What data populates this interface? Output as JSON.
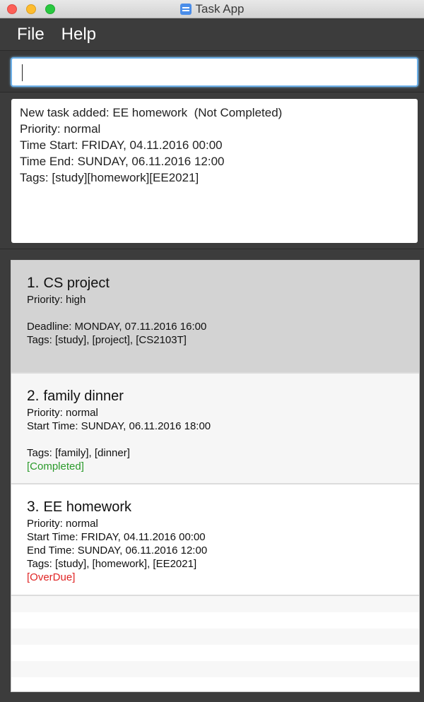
{
  "window": {
    "title": "Task App",
    "colors": {
      "close": "#fc5f57",
      "minimize": "#fdbc2e",
      "maximize": "#29c840",
      "accent": "#6db0e8"
    }
  },
  "menu": {
    "items": [
      "File",
      "Help"
    ]
  },
  "command": {
    "value": "",
    "placeholder": ""
  },
  "result": {
    "lines": [
      "New task added: EE homework  (Not Completed)",
      "Priority: normal",
      "Time Start: FRIDAY, 04.11.2016 00:00",
      "Time End: SUNDAY, 06.11.2016 12:00",
      "Tags: [study][homework][EE2021]"
    ]
  },
  "tasks": [
    {
      "index": "1.",
      "name": "CS project",
      "lines": [
        "Priority: high",
        "",
        "Deadline: MONDAY, 07.11.2016 16:00",
        "Tags: [study], [project], [CS2103T]"
      ],
      "status": ""
    },
    {
      "index": "2.",
      "name": "family dinner",
      "lines": [
        "Priority: normal",
        "Start Time: SUNDAY, 06.11.2016 18:00",
        "",
        "Tags: [family], [dinner]"
      ],
      "status": "[Completed]",
      "status_color": "#2a9a2a"
    },
    {
      "index": "3.",
      "name": "EE homework",
      "lines": [
        "Priority: normal",
        "Start Time: FRIDAY, 04.11.2016 00:00",
        "End Time: SUNDAY, 06.11.2016 12:00",
        "Tags: [study], [homework], [EE2021]"
      ],
      "status": "[OverDue]",
      "status_color": "#e02424"
    }
  ]
}
